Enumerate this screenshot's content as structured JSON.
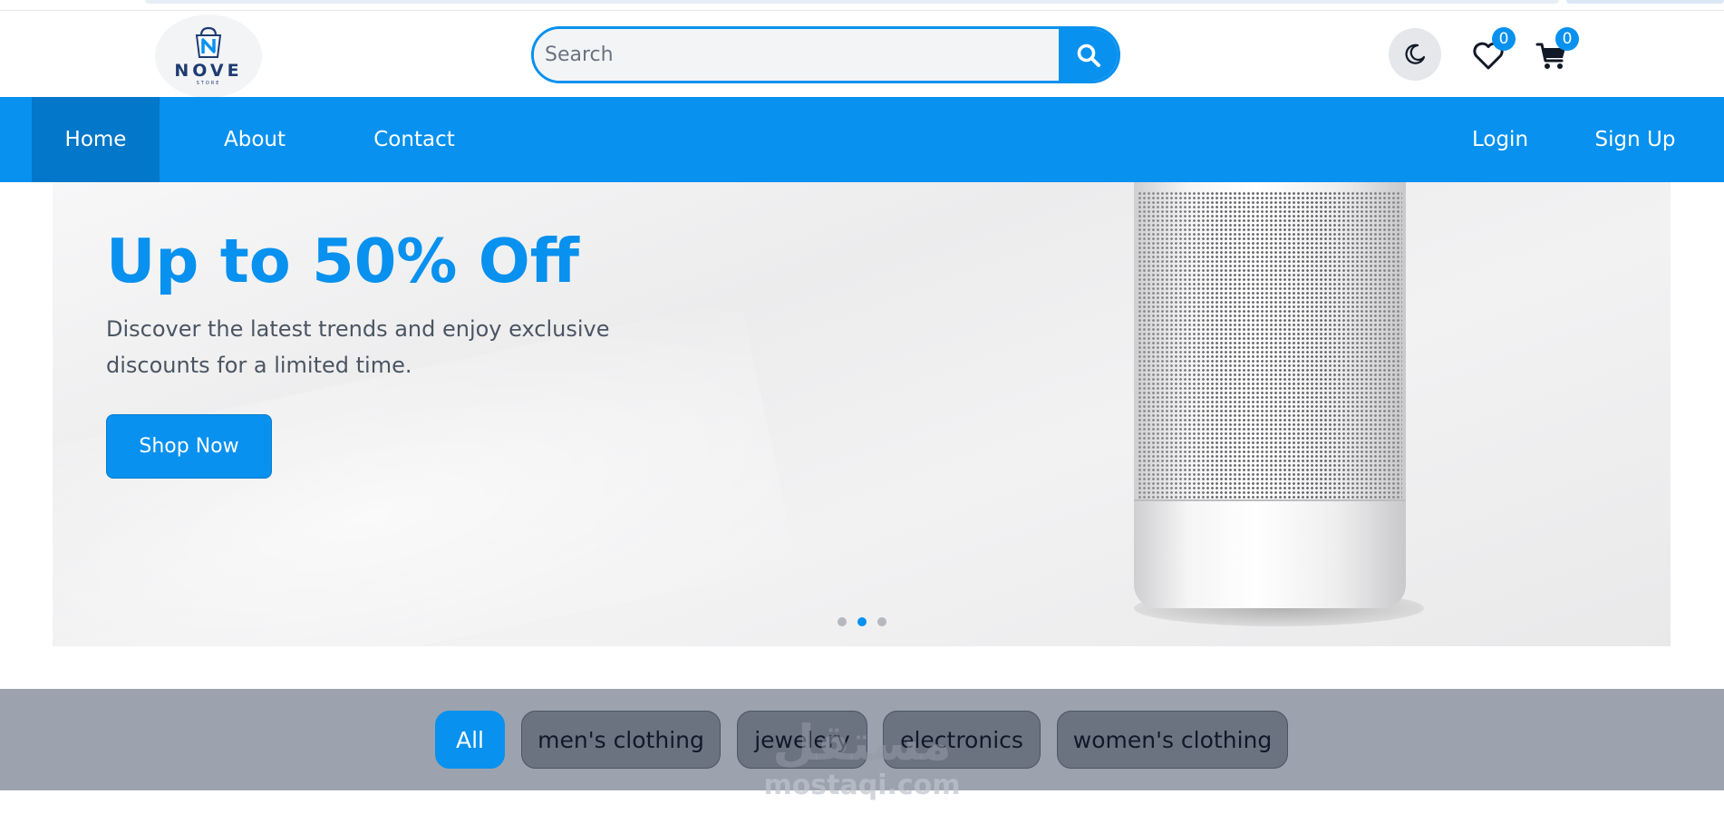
{
  "logo": {
    "brand": "NOVE",
    "sub": "STORE"
  },
  "search": {
    "placeholder": "Search"
  },
  "header": {
    "wishlist_count": "0",
    "cart_count": "0"
  },
  "nav": {
    "left": [
      "Home",
      "About",
      "Contact"
    ],
    "right": [
      "Login",
      "Sign Up"
    ],
    "active": "Home"
  },
  "hero": {
    "title": "Up to 50% Off",
    "description": "Discover the latest trends and enjoy exclusive discounts for a limited time.",
    "button": "Shop Now",
    "slides": 3,
    "active_slide": 2
  },
  "filters": {
    "items": [
      "All",
      "men's clothing",
      "jewelery",
      "electronics",
      "women's clothing"
    ],
    "active": "All"
  },
  "watermark": {
    "arabic": "مستقل",
    "latin": "mostaqi.com"
  },
  "colors": {
    "primary": "#0891ef",
    "primary_dark": "#0377c9",
    "filter_bar": "#9ca3af",
    "chip": "#6b7280"
  }
}
